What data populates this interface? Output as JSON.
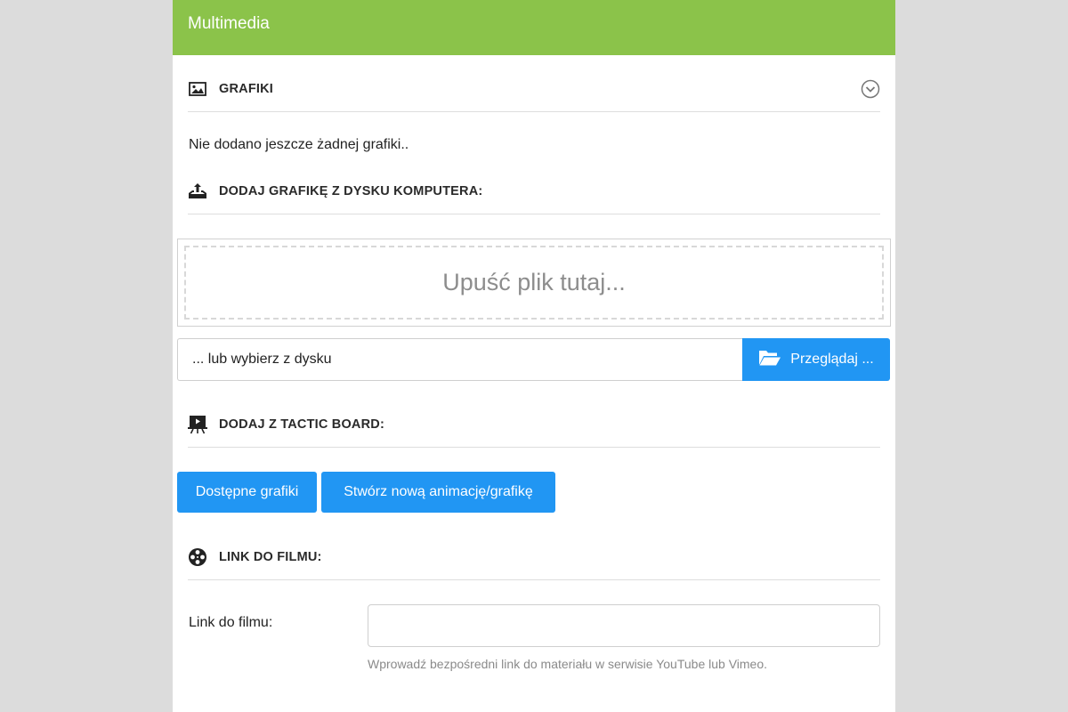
{
  "panel": {
    "title": "Multimedia"
  },
  "grafiki": {
    "title": "GRAFIKI",
    "empty_message": "Nie dodano jeszcze żadnej grafiki.."
  },
  "upload": {
    "title": "DODAJ GRAFIKĘ Z DYSKU KOMPUTERA:",
    "dropzone_text": "Upuść plik tutaj...",
    "choose_text": "... lub wybierz z dysku",
    "browse_label": "Przeglądaj ..."
  },
  "tactic_board": {
    "title": "DODAJ Z TACTIC BOARD:",
    "available_label": "Dostępne grafiki",
    "create_label": "Stwórz nową animację/grafikę"
  },
  "film": {
    "title": "LINK DO FILMU:",
    "field_label": "Link do filmu:",
    "field_value": "",
    "help_text": "Wprowadź bezpośredni link do materiału w serwisie YouTube lub Vimeo."
  },
  "colors": {
    "header_green": "#8bc34a",
    "button_blue": "#2196f3"
  }
}
